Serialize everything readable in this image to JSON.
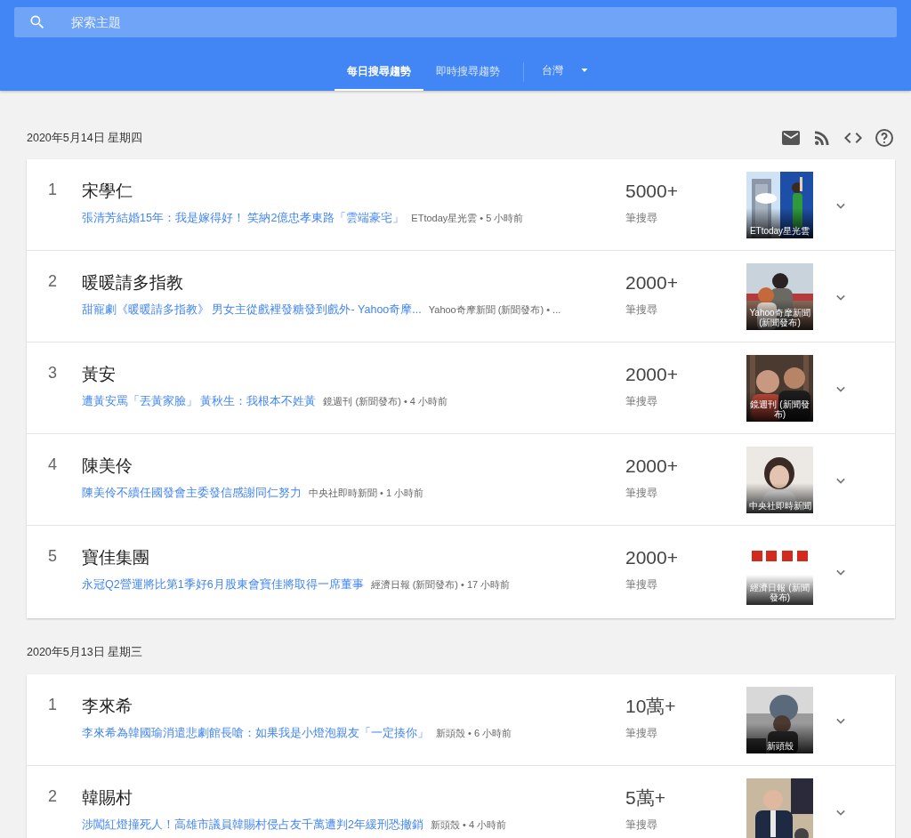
{
  "search": {
    "placeholder": "探索主題"
  },
  "tabs": [
    {
      "label": "每日搜尋趨勢",
      "selected": true
    },
    {
      "label": "即時搜尋趨勢",
      "selected": false
    }
  ],
  "region": {
    "label": "台灣"
  },
  "days": [
    {
      "date": "2020年5月14日 星期四",
      "actions": [
        {
          "kind": "email"
        },
        {
          "kind": "rss"
        },
        {
          "kind": "embed"
        },
        {
          "kind": "help"
        }
      ],
      "trends": [
        {
          "rank": "1",
          "title": "宋學仁",
          "article": "張清芳結婚15年：我是嫁得好！ 笑納2億忠孝東路「雲端豪宅」",
          "source": "ETtoday星光雲 • 5 小時前",
          "count": "5000+",
          "count_label": "筆搜尋",
          "thumb_caption": "ETtoday星光雲"
        },
        {
          "rank": "2",
          "title": "暖暖請多指教",
          "article": "甜寵劇《暖暖請多指教》 男女主從戲裡發糖發到戲外- Yahoo奇摩...",
          "source": "Yahoo奇摩新聞 (新聞發布) • ...",
          "count": "2000+",
          "count_label": "筆搜尋",
          "thumb_caption": "Yahoo奇摩新聞 (新聞發布)"
        },
        {
          "rank": "3",
          "title": "黃安",
          "article": "遭黃安罵「丟黃家臉」 黃秋生：我根本不姓黃",
          "source": "鏡週刊 (新聞發布) • 4 小時前",
          "count": "2000+",
          "count_label": "筆搜尋",
          "thumb_caption": "鏡週刊 (新聞發布)"
        },
        {
          "rank": "4",
          "title": "陳美伶",
          "article": "陳美伶不續任國發會主委發信感謝同仁努力",
          "source": "中央社即時新聞 • 1 小時前",
          "count": "2000+",
          "count_label": "筆搜尋",
          "thumb_caption": "中央社即時新聞"
        },
        {
          "rank": "5",
          "title": "寶佳集團",
          "article": "永冠Q2營運將比第1季好6月股東會寶佳將取得一席董事",
          "source": "經濟日報 (新聞發布) • 17 小時前",
          "count": "2000+",
          "count_label": "筆搜尋",
          "thumb_caption": "經濟日報 (新聞發布)"
        }
      ]
    },
    {
      "date": "2020年5月13日 星期三",
      "trends": [
        {
          "rank": "1",
          "title": "李來希",
          "article": "李來希為韓國瑜消遣悲劇館長嗆：如果我是小燈泡親友「一定揍你」",
          "source": "新頭殼 • 6 小時前",
          "count": "10萬+",
          "count_label": "筆搜尋",
          "thumb_caption": "新頭殼"
        },
        {
          "rank": "2",
          "title": "韓賜村",
          "article": "涉闖紅燈撞死人！高雄市議員韓賜村侵占友千萬遭判2年緩刑恐撤銷",
          "source": "新頭殼 • 4 小時前",
          "count": "5萬+",
          "count_label": "筆搜尋"
        }
      ]
    }
  ]
}
